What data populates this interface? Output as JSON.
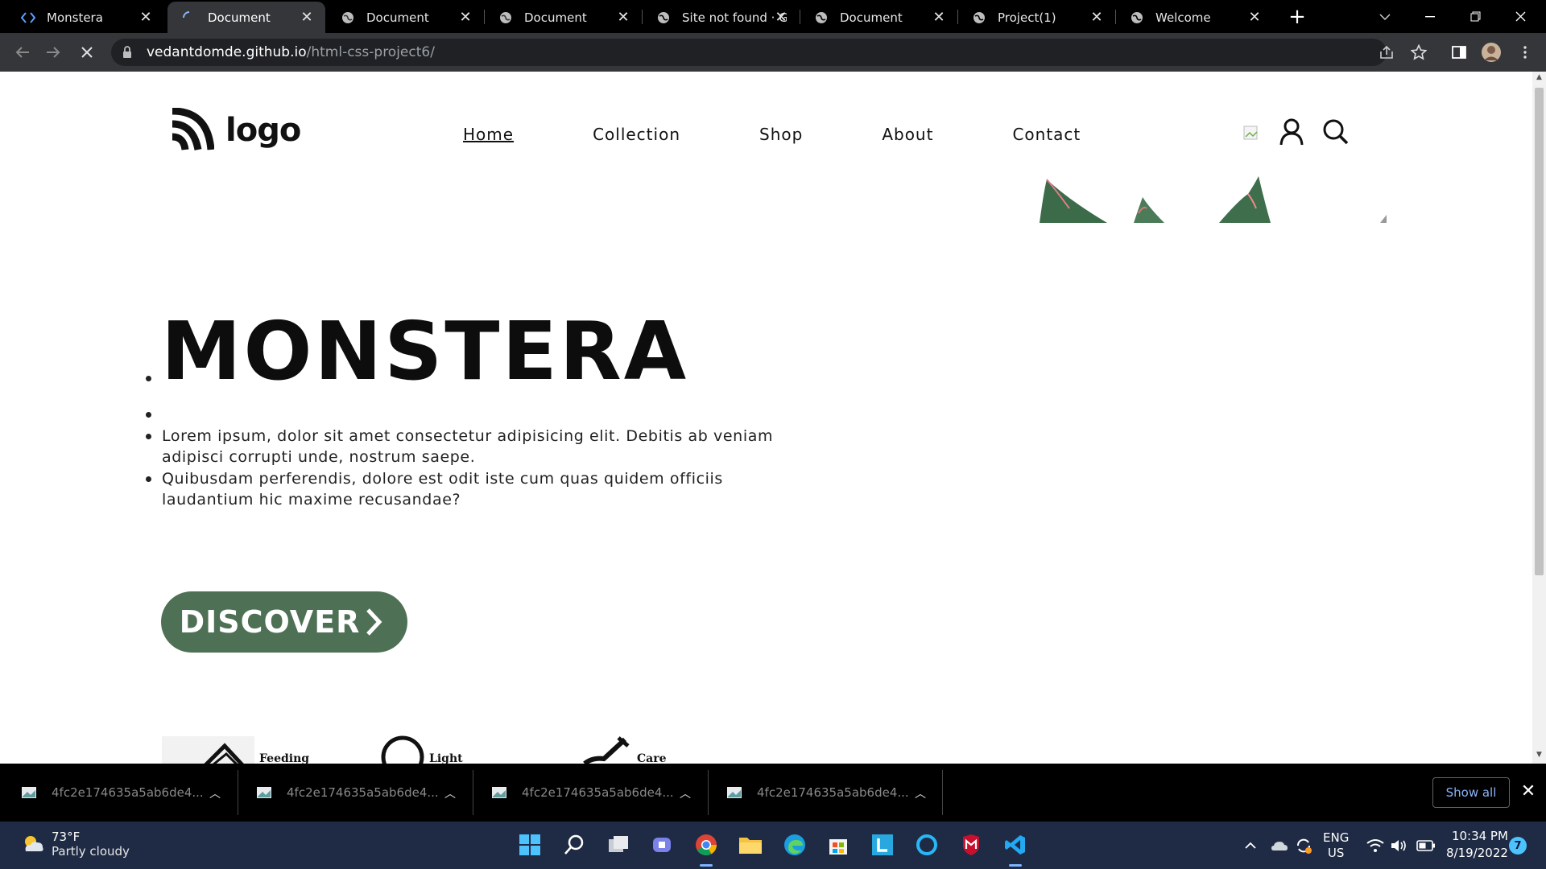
{
  "browser": {
    "tabs": [
      {
        "title": "Monstera",
        "favicon": "code-brackets-icon"
      },
      {
        "title": "Document",
        "favicon": "loading-spinner-icon",
        "active": true
      },
      {
        "title": "Document",
        "favicon": "globe-icon"
      },
      {
        "title": "Document",
        "favicon": "globe-icon"
      },
      {
        "title": "Site not found · G",
        "favicon": "globe-icon"
      },
      {
        "title": "Document",
        "favicon": "globe-icon"
      },
      {
        "title": "Project(1)",
        "favicon": "globe-icon"
      },
      {
        "title": "Welcome",
        "favicon": "globe-icon"
      }
    ],
    "url_host": "vedantdomde.github.io",
    "url_path": "/html-css-project6/"
  },
  "site": {
    "logo_text": "logo",
    "nav": [
      {
        "label": "Home",
        "active": true
      },
      {
        "label": "Collection"
      },
      {
        "label": "Shop"
      },
      {
        "label": "About"
      },
      {
        "label": "Contact"
      }
    ],
    "hero": {
      "title": "MONSTERA",
      "bullets": [
        "Lorem ipsum, dolor sit amet consectetur adipisicing elit. Debitis ab veniam adipisci corrupti unde, nostrum saepe.",
        "Quibusdam perferendis, dolore est odit iste cum quas quidem officiis laudantium hic maxime recusandae?"
      ],
      "cta_label": "DISCOVER"
    },
    "features": [
      {
        "label": "Feeding",
        "icon": "feeding-icon"
      },
      {
        "label": "Light",
        "icon": "light-icon"
      },
      {
        "label": "Care",
        "icon": "care-icon"
      }
    ],
    "accent_color": "#4e7155"
  },
  "downloads": {
    "items": [
      {
        "name": "4fc2e174635a5ab6de4..."
      },
      {
        "name": "4fc2e174635a5ab6de4..."
      },
      {
        "name": "4fc2e174635a5ab6de4..."
      },
      {
        "name": "4fc2e174635a5ab6de4..."
      }
    ],
    "show_all": "Show all"
  },
  "taskbar": {
    "weather_temp": "73°F",
    "weather_condition": "Partly cloudy",
    "language_top": "ENG",
    "language_bottom": "US",
    "time": "10:34 PM",
    "date": "8/19/2022",
    "notification_count": "7"
  }
}
